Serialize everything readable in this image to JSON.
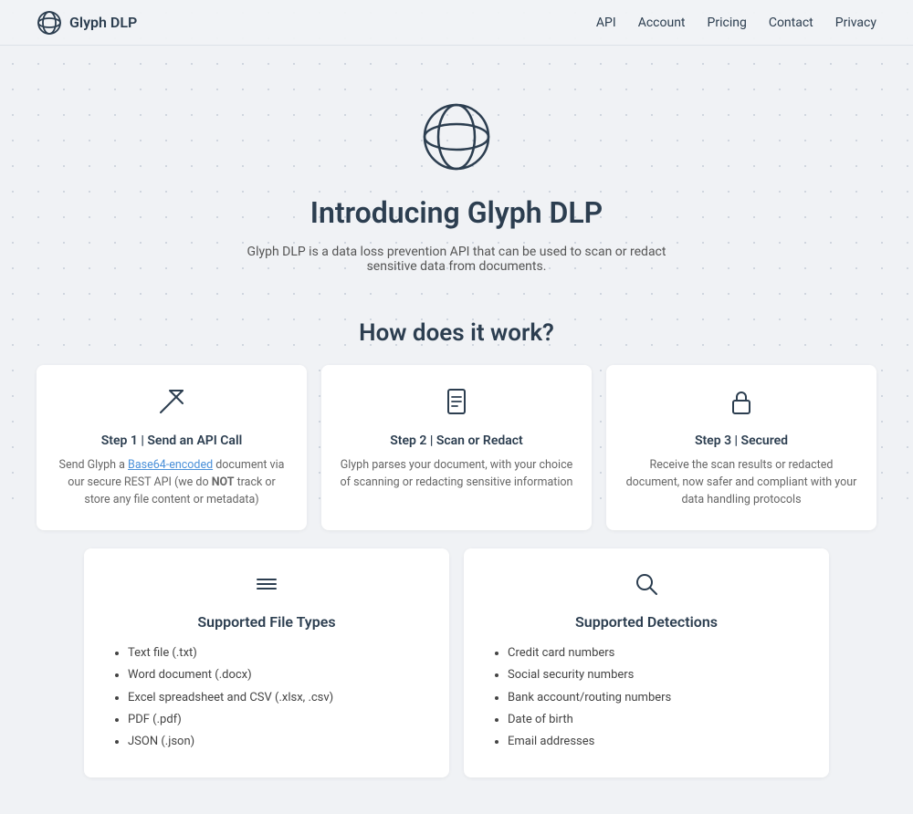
{
  "navbar": {
    "brand": "Glyph DLP",
    "links": [
      {
        "label": "API",
        "href": "#"
      },
      {
        "label": "Account",
        "href": "#"
      },
      {
        "label": "Pricing",
        "href": "#"
      },
      {
        "label": "Contact",
        "href": "#"
      },
      {
        "label": "Privacy",
        "href": "#"
      }
    ]
  },
  "hero": {
    "title": "Introducing Glyph DLP",
    "subtitle": "Glyph DLP is a data loss prevention API that can be used to scan or redact sensitive data from documents."
  },
  "how_it_works": {
    "section_title": "How does it work?",
    "steps": [
      {
        "step_label": "Step 1 | Send an API Call",
        "description_before": "Send Glyph a ",
        "link_text": "Base64-encoded",
        "description_after": " document via our secure REST API (we do ",
        "bold_text": "NOT",
        "description_end": " track or store any file content or metadata)"
      },
      {
        "step_label": "Step 2 | Scan or Redact",
        "description": "Glyph parses your document, with your choice of scanning or redacting sensitive information"
      },
      {
        "step_label": "Step 3 | Secured",
        "description": "Receive the scan results or redacted document, now safer and compliant with your data handling protocols"
      }
    ]
  },
  "supported_file_types": {
    "title": "Supported File Types",
    "items": [
      "Text file (.txt)",
      "Word document (.docx)",
      "Excel spreadsheet and CSV (.xlsx, .csv)",
      "PDF (.pdf)",
      "JSON (.json)"
    ]
  },
  "supported_detections": {
    "title": "Supported Detections",
    "items": [
      "Credit card numbers",
      "Social security numbers",
      "Bank account/routing numbers",
      "Date of birth",
      "Email addresses"
    ]
  }
}
